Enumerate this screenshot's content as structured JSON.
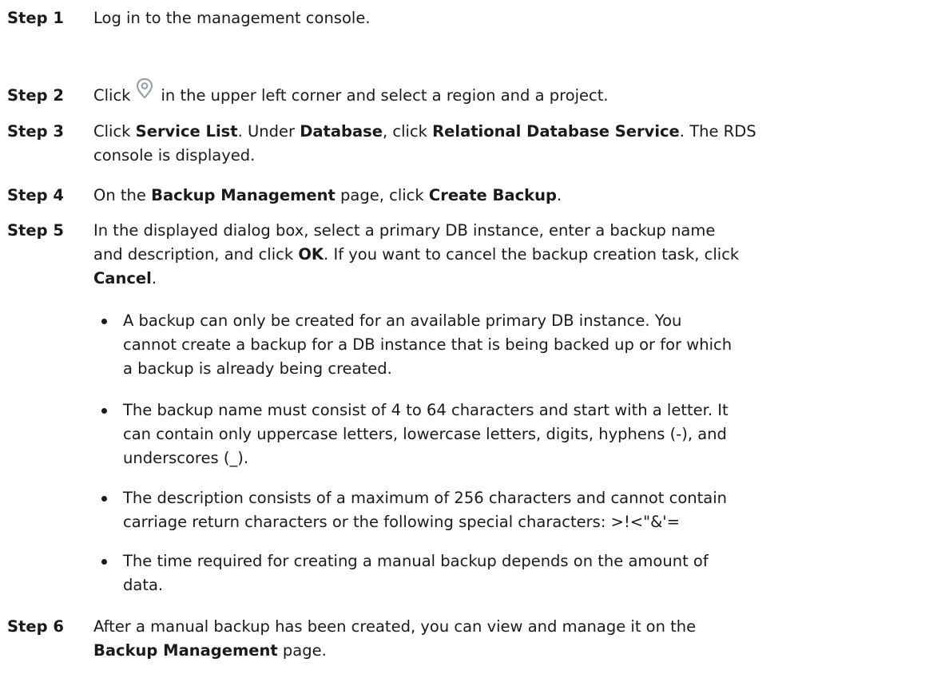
{
  "steps": [
    {
      "label": "Step 1",
      "lines": [
        "Log in to the management console."
      ]
    },
    {
      "label": "Step 2",
      "before_icon": "Click",
      "icon": "location-pin-icon",
      "after_icon": "in the upper left corner and select a region and a project."
    },
    {
      "label": "Step 3",
      "l1": {
        "t1": "Click ",
        "b1": "Service List",
        "t2": ". Under ",
        "b2": "Database",
        "t3": ", click ",
        "b3": "Relational Database Service",
        "t4": ". The RDS"
      },
      "l2": "console is displayed."
    },
    {
      "label": "Step 4",
      "t1": "On the ",
      "b1": "Backup Management",
      "t2": " page, click ",
      "b2": "Create Backup",
      "t3": "."
    },
    {
      "label": "Step 5",
      "l1": "In the displayed dialog box, select a primary DB instance, enter a backup name",
      "l2": {
        "t1": "and description, and click ",
        "b1": "OK",
        "t2": ". If you want to cancel the backup creation task, click"
      },
      "l3": {
        "b1": "Cancel",
        "t1": "."
      },
      "bullets": [
        [
          "A backup can only be created for an available primary DB instance. You",
          "cannot create a backup for a DB instance that is being backed up or for which",
          "a backup is already being created."
        ],
        [
          "The backup name must consist of 4 to 64 characters and start with a letter. It",
          "can contain only uppercase letters, lowercase letters, digits, hyphens (-), and",
          "underscores (_)."
        ],
        [
          "The description consists of a maximum of 256 characters and cannot contain",
          "carriage return characters or the following special characters: >!<\"&'="
        ],
        [
          "The time required for creating a manual backup depends on the amount of",
          "data."
        ]
      ]
    },
    {
      "label": "Step 6",
      "l1": "After a manual backup has been created, you can view and manage it on the",
      "l2": {
        "b1": "Backup Management",
        "t1": " page."
      }
    }
  ],
  "colors": {
    "text": "#1a1a1a",
    "icon": "#9aa0a6"
  }
}
